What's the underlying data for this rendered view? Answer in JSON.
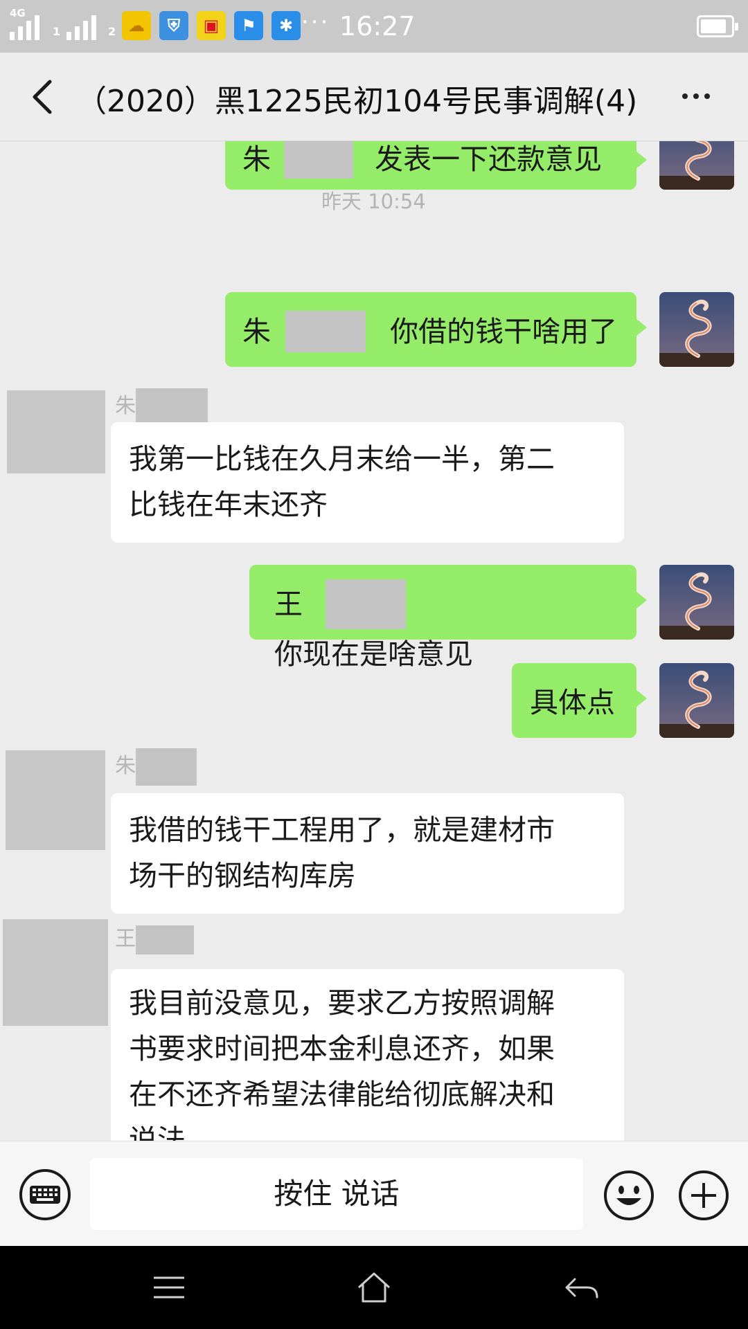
{
  "status_bar": {
    "network": "4G",
    "sim1": "1",
    "sim2": "2",
    "more": "···",
    "time": "16:27",
    "battery_level": 0.85,
    "notification_icons": [
      "weather-icon",
      "shield-icon",
      "car-icon",
      "flag-icon",
      "snowflake-icon"
    ]
  },
  "header": {
    "title": "（2020）黑1225民初104号民事调解(4)",
    "back_icon": "chevron-left-icon",
    "more_icon": "more-dots-icon"
  },
  "messages": {
    "m1": {
      "pre": "朱",
      "post": "发表一下还款意见"
    },
    "timestamp": "昨天 10:54",
    "m2": {
      "pre": "朱",
      "post": "你借的钱干啥用了"
    },
    "m3": {
      "sender": "朱",
      "line1": "我第一比钱在久月末给一半，第二",
      "line2": "比钱在年末还齐"
    },
    "m4": {
      "pre": "王",
      "post": "你现在是啥意见"
    },
    "m5": {
      "text": "具体点"
    },
    "m6": {
      "sender": "朱",
      "line1": "我借的钱干工程用了，就是建材市",
      "line2": "场干的钢结构库房"
    },
    "m7": {
      "sender": "王",
      "line1": "我目前没意见，要求乙方按照调解",
      "line2": "书要求时间把本金利息还齐，如果",
      "line3": "在不还齐希望法律能给彻底解决和",
      "line4": "说法"
    }
  },
  "input_bar": {
    "hold_to_talk": "按住 说话",
    "keyboard_icon": "keyboard-icon",
    "emoji_icon": "smiley-icon",
    "plus_icon": "plus-circle-icon"
  },
  "nav_bar": {
    "menu_icon": "menu-icon",
    "home_icon": "home-icon",
    "back_icon": "back-arrow-icon"
  },
  "colors": {
    "outgoing_bubble": "#95ec69",
    "incoming_bubble": "#ffffff",
    "chat_background": "#ececec"
  }
}
